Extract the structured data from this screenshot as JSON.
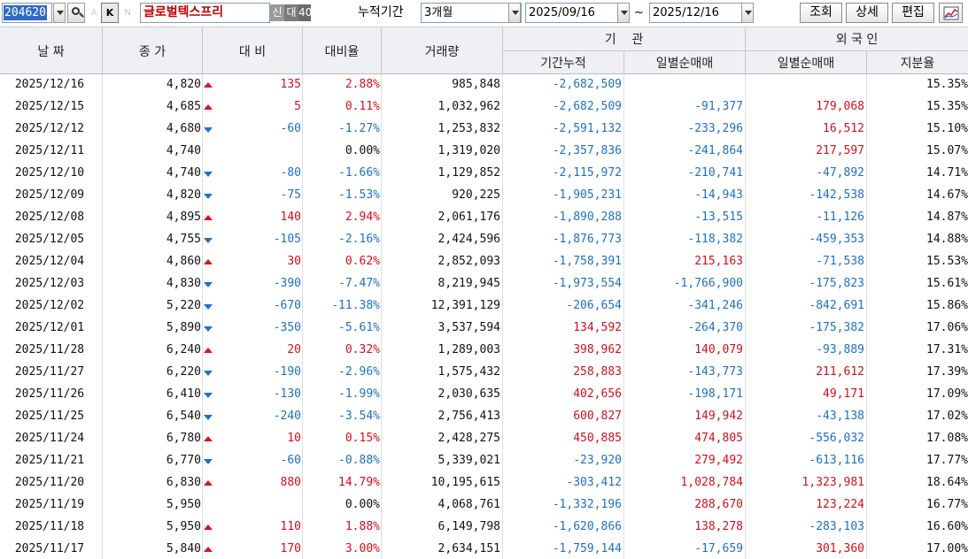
{
  "toolbar": {
    "code": "204620",
    "a_label": "A",
    "k_label": "K",
    "n_label": "N",
    "stock_name": "글로벌텍스프리",
    "tags": [
      "신",
      "대",
      "40"
    ],
    "period_label": "누적기간",
    "period_value": "3개월",
    "date_from": "2025/09/16",
    "tilde": "~",
    "date_to": "2025/12/16",
    "view_label": "조회",
    "detail_label": "상세",
    "edit_label": "편집",
    "chart_icon": "chart-icon"
  },
  "header": {
    "date": "날 짜",
    "close": "종 가",
    "diff": "대 비",
    "rate": "대비율",
    "volume": "거래량",
    "institution": "기    관",
    "inst_cum": "기간누적",
    "inst_day": "일별순매매",
    "foreign": "외 국 인",
    "for_day": "일별순매매",
    "share": "지분율"
  },
  "colors": {
    "up": "#d0101c",
    "down": "#1f6fc2",
    "neutral": "#111111"
  },
  "rows": [
    {
      "date": "2025/12/16",
      "close": "4,820",
      "dir": "up",
      "diff": "135",
      "rate": "2.88%",
      "volume": "985,848",
      "inst_cum": "-2,682,509",
      "inst_day": "",
      "for_day": "",
      "share": "15.35%"
    },
    {
      "date": "2025/12/15",
      "close": "4,685",
      "dir": "up",
      "diff": "5",
      "rate": "0.11%",
      "volume": "1,032,962",
      "inst_cum": "-2,682,509",
      "inst_day": "-91,377",
      "for_day": "179,068",
      "share": "15.35%"
    },
    {
      "date": "2025/12/12",
      "close": "4,680",
      "dir": "down",
      "diff": "-60",
      "rate": "-1.27%",
      "volume": "1,253,832",
      "inst_cum": "-2,591,132",
      "inst_day": "-233,296",
      "for_day": "16,512",
      "share": "15.10%"
    },
    {
      "date": "2025/12/11",
      "close": "4,740",
      "dir": "flat",
      "diff": "",
      "rate": "0.00%",
      "volume": "1,319,020",
      "inst_cum": "-2,357,836",
      "inst_day": "-241,864",
      "for_day": "217,597",
      "share": "15.07%"
    },
    {
      "date": "2025/12/10",
      "close": "4,740",
      "dir": "down",
      "diff": "-80",
      "rate": "-1.66%",
      "volume": "1,129,852",
      "inst_cum": "-2,115,972",
      "inst_day": "-210,741",
      "for_day": "-47,892",
      "share": "14.71%"
    },
    {
      "date": "2025/12/09",
      "close": "4,820",
      "dir": "down",
      "diff": "-75",
      "rate": "-1.53%",
      "volume": "920,225",
      "inst_cum": "-1,905,231",
      "inst_day": "-14,943",
      "for_day": "-142,538",
      "share": "14.67%"
    },
    {
      "date": "2025/12/08",
      "close": "4,895",
      "dir": "up",
      "diff": "140",
      "rate": "2.94%",
      "volume": "2,061,176",
      "inst_cum": "-1,890,288",
      "inst_day": "-13,515",
      "for_day": "-11,126",
      "share": "14.87%"
    },
    {
      "date": "2025/12/05",
      "close": "4,755",
      "dir": "down",
      "diff": "-105",
      "rate": "-2.16%",
      "volume": "2,424,596",
      "inst_cum": "-1,876,773",
      "inst_day": "-118,382",
      "for_day": "-459,353",
      "share": "14.88%"
    },
    {
      "date": "2025/12/04",
      "close": "4,860",
      "dir": "up",
      "diff": "30",
      "rate": "0.62%",
      "volume": "2,852,093",
      "inst_cum": "-1,758,391",
      "inst_day": "215,163",
      "for_day": "-71,538",
      "share": "15.53%"
    },
    {
      "date": "2025/12/03",
      "close": "4,830",
      "dir": "down",
      "diff": "-390",
      "rate": "-7.47%",
      "volume": "8,219,945",
      "inst_cum": "-1,973,554",
      "inst_day": "-1,766,900",
      "for_day": "-175,823",
      "share": "15.61%"
    },
    {
      "date": "2025/12/02",
      "close": "5,220",
      "dir": "down",
      "diff": "-670",
      "rate": "-11.38%",
      "volume": "12,391,129",
      "inst_cum": "-206,654",
      "inst_day": "-341,246",
      "for_day": "-842,691",
      "share": "15.86%"
    },
    {
      "date": "2025/12/01",
      "close": "5,890",
      "dir": "down",
      "diff": "-350",
      "rate": "-5.61%",
      "volume": "3,537,594",
      "inst_cum": "134,592",
      "inst_day": "-264,370",
      "for_day": "-175,382",
      "share": "17.06%"
    },
    {
      "date": "2025/11/28",
      "close": "6,240",
      "dir": "up",
      "diff": "20",
      "rate": "0.32%",
      "volume": "1,289,003",
      "inst_cum": "398,962",
      "inst_day": "140,079",
      "for_day": "-93,889",
      "share": "17.31%"
    },
    {
      "date": "2025/11/27",
      "close": "6,220",
      "dir": "down",
      "diff": "-190",
      "rate": "-2.96%",
      "volume": "1,575,432",
      "inst_cum": "258,883",
      "inst_day": "-143,773",
      "for_day": "211,612",
      "share": "17.39%"
    },
    {
      "date": "2025/11/26",
      "close": "6,410",
      "dir": "down",
      "diff": "-130",
      "rate": "-1.99%",
      "volume": "2,030,635",
      "inst_cum": "402,656",
      "inst_day": "-198,171",
      "for_day": "49,171",
      "share": "17.09%"
    },
    {
      "date": "2025/11/25",
      "close": "6,540",
      "dir": "down",
      "diff": "-240",
      "rate": "-3.54%",
      "volume": "2,756,413",
      "inst_cum": "600,827",
      "inst_day": "149,942",
      "for_day": "-43,138",
      "share": "17.02%"
    },
    {
      "date": "2025/11/24",
      "close": "6,780",
      "dir": "up",
      "diff": "10",
      "rate": "0.15%",
      "volume": "2,428,275",
      "inst_cum": "450,885",
      "inst_day": "474,805",
      "for_day": "-556,032",
      "share": "17.08%"
    },
    {
      "date": "2025/11/21",
      "close": "6,770",
      "dir": "down",
      "diff": "-60",
      "rate": "-0.88%",
      "volume": "5,339,021",
      "inst_cum": "-23,920",
      "inst_day": "279,492",
      "for_day": "-613,116",
      "share": "17.77%"
    },
    {
      "date": "2025/11/20",
      "close": "6,830",
      "dir": "up",
      "diff": "880",
      "rate": "14.79%",
      "volume": "10,195,615",
      "inst_cum": "-303,412",
      "inst_day": "1,028,784",
      "for_day": "1,323,981",
      "share": "18.64%"
    },
    {
      "date": "2025/11/19",
      "close": "5,950",
      "dir": "flat",
      "diff": "",
      "rate": "0.00%",
      "volume": "4,068,761",
      "inst_cum": "-1,332,196",
      "inst_day": "288,670",
      "for_day": "123,224",
      "share": "16.77%"
    },
    {
      "date": "2025/11/18",
      "close": "5,950",
      "dir": "up",
      "diff": "110",
      "rate": "1.88%",
      "volume": "6,149,798",
      "inst_cum": "-1,620,866",
      "inst_day": "138,278",
      "for_day": "-283,103",
      "share": "16.60%"
    },
    {
      "date": "2025/11/17",
      "close": "5,840",
      "dir": "up",
      "diff": "170",
      "rate": "3.00%",
      "volume": "2,634,151",
      "inst_cum": "-1,759,144",
      "inst_day": "-17,659",
      "for_day": "301,360",
      "share": "17.00%"
    }
  ]
}
